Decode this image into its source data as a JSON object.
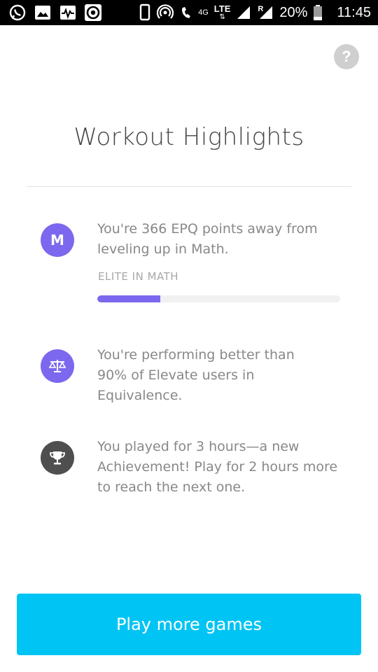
{
  "status_bar": {
    "network_4g": "4G",
    "network_lte": "LTE",
    "roaming": "R",
    "battery": "20%",
    "time": "11:45",
    "icons": [
      "whatsapp-icon",
      "gallery-icon",
      "pulse-icon",
      "circle-app-icon",
      "phone-icon",
      "hotspot-icon",
      "call-icon",
      "signal-icon",
      "battery-icon"
    ]
  },
  "header": {
    "help_label": "?"
  },
  "title": "Workout Highlights",
  "highlights": [
    {
      "icon": "math-badge-icon",
      "badge_letter": "M",
      "text": "You're 366 EPQ points away from leveling up in Math.",
      "level_label": "ELITE IN MATH",
      "progress": 0.26
    },
    {
      "icon": "scale-icon",
      "text": "You're performing better than 90% of Elevate users in Equivalence."
    },
    {
      "icon": "trophy-icon",
      "text": "You played for 3 hours—a new Achievement! Play for 2 hours more to reach the next one."
    }
  ],
  "cta": {
    "label": "Play more games"
  },
  "colors": {
    "accent_purple": "#7b68ee",
    "trophy_bg": "#4f4f4f",
    "button_blue": "#00c4f3",
    "text_gray": "#888888"
  }
}
